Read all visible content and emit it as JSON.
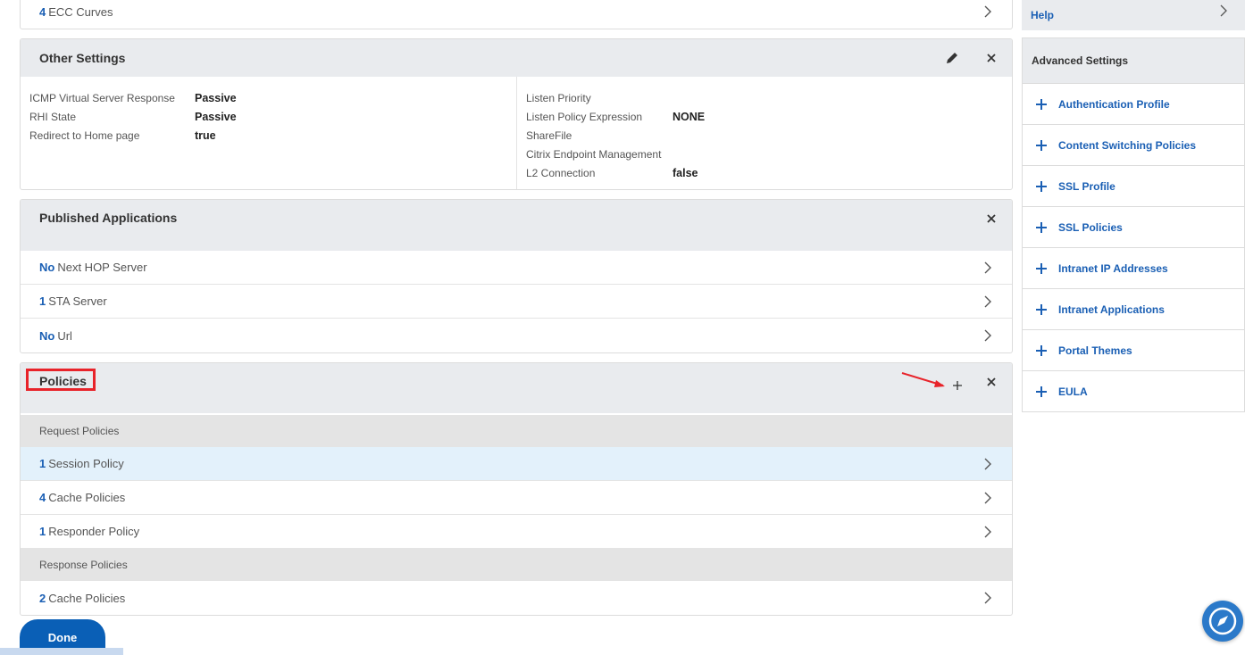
{
  "ecc_row": {
    "num": "4",
    "label": "ECC Curves"
  },
  "other_settings": {
    "title": "Other Settings",
    "left": [
      {
        "key": "ICMP Virtual Server Response",
        "value": "Passive"
      },
      {
        "key": "RHI State",
        "value": "Passive"
      },
      {
        "key": "Redirect to Home page",
        "value": "true"
      }
    ],
    "right": [
      {
        "key": "Listen Priority",
        "value": ""
      },
      {
        "key": "Listen Policy Expression",
        "value": "NONE"
      },
      {
        "key": "ShareFile",
        "value": ""
      },
      {
        "key": "Citrix Endpoint Management",
        "value": ""
      },
      {
        "key": "L2 Connection",
        "value": "false"
      }
    ]
  },
  "published_apps": {
    "title": "Published Applications",
    "rows": [
      {
        "num": "No",
        "label": "Next HOP Server"
      },
      {
        "num": "1",
        "label": "STA Server"
      },
      {
        "num": "No",
        "label": "Url"
      }
    ]
  },
  "policies": {
    "title": "Policies",
    "request_label": "Request Policies",
    "request_rows": [
      {
        "num": "1",
        "label": "Session Policy"
      },
      {
        "num": "4",
        "label": "Cache Policies"
      },
      {
        "num": "1",
        "label": "Responder Policy"
      }
    ],
    "response_label": "Response Policies",
    "response_rows": [
      {
        "num": "2",
        "label": "Cache Policies"
      }
    ]
  },
  "done_label": "Done",
  "sidebar": {
    "help_label": "Help",
    "advanced_title": "Advanced Settings",
    "items": [
      "Authentication Profile",
      "Content Switching Policies",
      "SSL Profile",
      "SSL Policies",
      "Intranet IP Addresses",
      "Intranet Applications",
      "Portal Themes",
      "EULA"
    ]
  },
  "colors": {
    "accent": "#1a5fb4",
    "annotation": "#e8232a",
    "primary_button": "#0a5fb6"
  }
}
